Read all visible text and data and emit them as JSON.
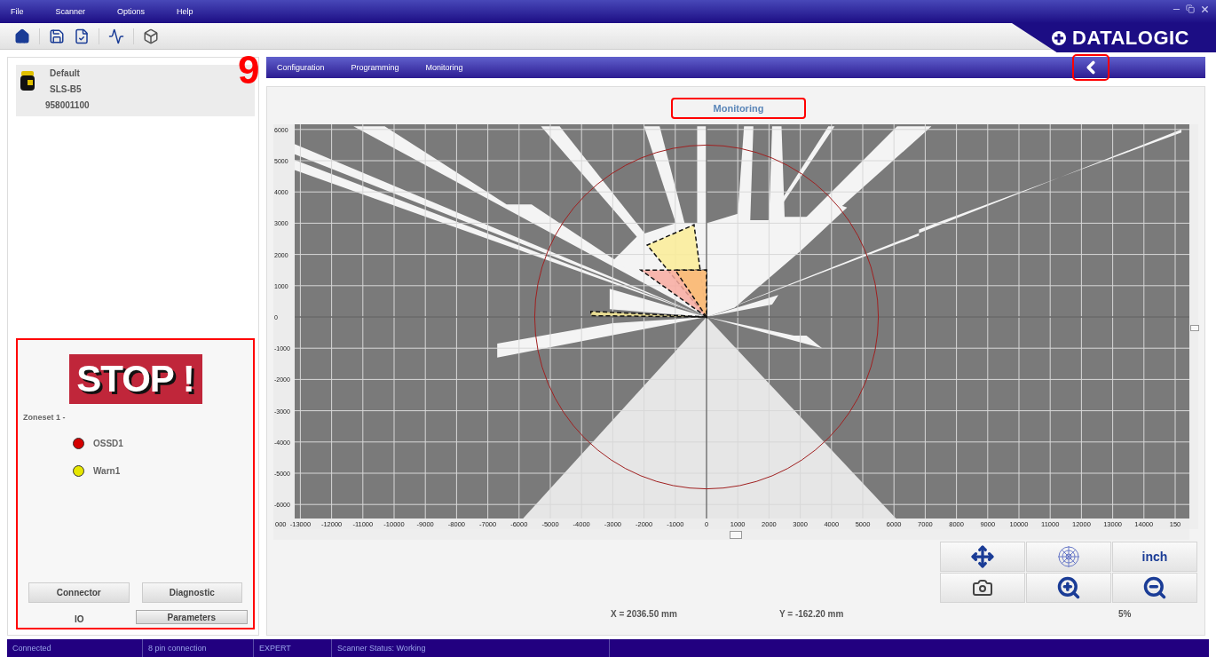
{
  "menu": [
    "File",
    "Scanner",
    "Options",
    "Help"
  ],
  "logo": {
    "text": "DATALOGIC"
  },
  "device": {
    "name": "Default",
    "model": "SLS-B5",
    "serial": "958001100"
  },
  "callout": {
    "text": "9"
  },
  "tabs": [
    "Configuration",
    "Programming",
    "Monitoring"
  ],
  "back_button": {
    "highlighted": true
  },
  "panel_title": {
    "text": "Monitoring",
    "highlighted": true
  },
  "io_panel": {
    "highlighted": true,
    "stop_sign": "STOP !",
    "zoneset": "Zoneset 1 -",
    "outputs": [
      {
        "name": "OSSD1",
        "color": "#d40000"
      },
      {
        "name": "Warn1",
        "color": "#e6e600"
      }
    ],
    "buttons": [
      "Connector",
      "Diagnostic"
    ],
    "tabs": [
      {
        "label": "IO",
        "selected": true
      },
      {
        "label": "Parameters",
        "selected": false
      }
    ]
  },
  "plot": {
    "x_ticks": [
      "000",
      "-13000",
      "-12000",
      "-11000",
      "-10000",
      "-9000",
      "-8000",
      "-7000",
      "-6000",
      "-5000",
      "-4000",
      "-3000",
      "-2000",
      "-1000",
      "0",
      "1000",
      "2000",
      "3000",
      "4000",
      "5000",
      "6000",
      "7000",
      "8000",
      "9000",
      "10000",
      "11000",
      "12000",
      "13000",
      "14000",
      "150"
    ],
    "y_ticks": [
      "6000",
      "5000",
      "4000",
      "3000",
      "2000",
      "1000",
      "0",
      "-1000",
      "-2000",
      "-3000",
      "-4000",
      "-5000",
      "-6000"
    ]
  },
  "tools": [
    {
      "kind": "pan"
    },
    {
      "kind": "grid"
    },
    {
      "kind": "unit",
      "label": "inch"
    },
    {
      "kind": "camera"
    },
    {
      "kind": "zoom_in"
    },
    {
      "kind": "zoom_out"
    }
  ],
  "readouts": {
    "x": "X = 2036.50 mm",
    "y": "Y = -162.20 mm",
    "zoom": "5%"
  },
  "status_bar": [
    "Connected",
    "8 pin connection",
    "EXPERT",
    "Scanner Status: Working"
  ]
}
